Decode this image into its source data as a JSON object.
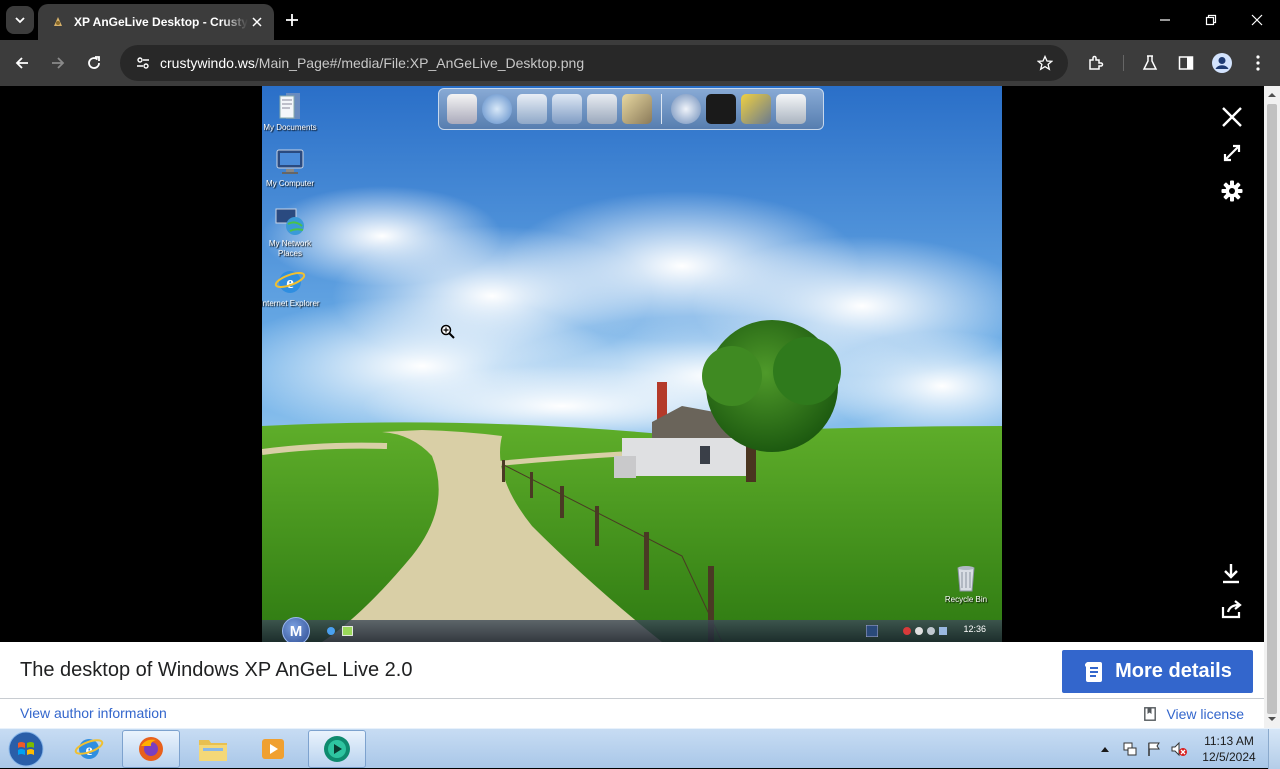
{
  "browser": {
    "tab_title": "XP AnGeLive Desktop - CrustyWindows",
    "url_host": "crustywindo.ws",
    "url_path": "/Main_Page#/media/File:XP_AnGeLive_Desktop.png"
  },
  "media": {
    "desktop_icons": [
      {
        "label": "My Documents"
      },
      {
        "label": "My Computer"
      },
      {
        "label": "My Network Places"
      },
      {
        "label": "Internet Explorer"
      }
    ],
    "recycle_bin_label": "Recycle Bin",
    "start_letter": "M",
    "xp_clock": "12:36"
  },
  "caption": {
    "title": "The desktop of Windows XP AnGeL Live 2.0",
    "more_details": "More details",
    "author_link": "View author information",
    "license_link": "View license"
  },
  "taskbar": {
    "time": "11:13 AM",
    "date": "12/5/2024"
  },
  "colors": {
    "chrome_bg": "#3c3c3c",
    "link": "#3366cc",
    "button": "#3366cc"
  }
}
